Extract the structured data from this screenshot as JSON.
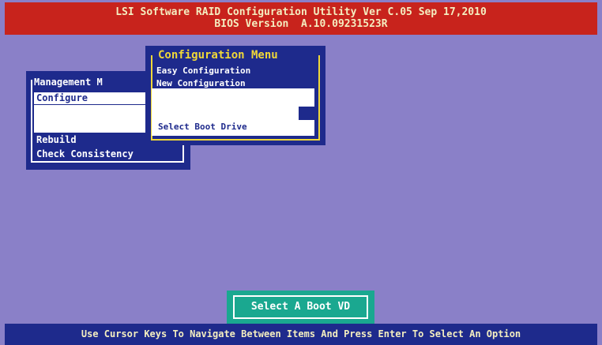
{
  "header": {
    "line1": "LSI Software RAID Configuration Utility Ver C.05 Sep 17,2010",
    "line2": "BIOS Version  A.10.09231523R"
  },
  "management_menu": {
    "title": "Management M",
    "items": [
      "Configure",
      "Rebuild",
      "Check Consistency"
    ],
    "selected_index": 0
  },
  "configuration_menu": {
    "title": "Configuration Menu",
    "items": [
      "Easy Configuration",
      "New Configuration"
    ],
    "overlay_label": "Select Boot Drive"
  },
  "status_box": {
    "label": "Select A Boot VD"
  },
  "footer": {
    "hint": "Use Cursor Keys To Navigate Between Items And Press Enter To Select An Option"
  },
  "colors": {
    "background": "#8a80c8",
    "title_bar": "#c8231c",
    "panel": "#1e2a8c",
    "accent_yellow": "#f0d838",
    "status_box": "#1aa890"
  }
}
